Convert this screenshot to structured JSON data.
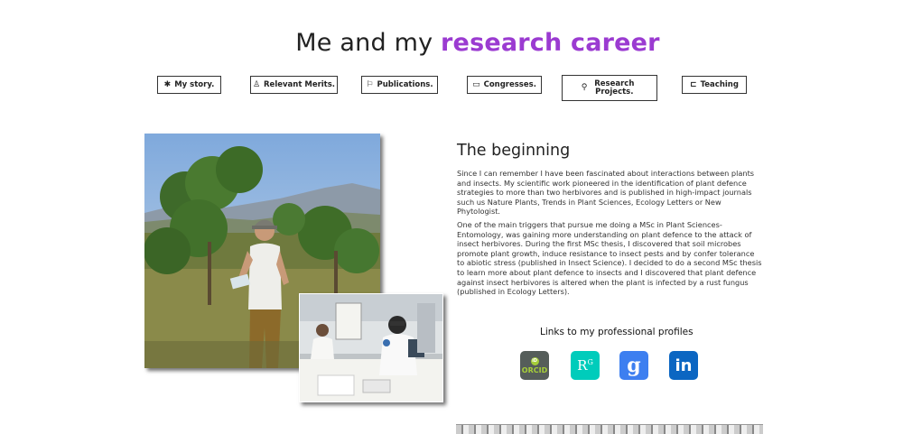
{
  "header": {
    "title_plain": "Me and my",
    "title_accent": "research career"
  },
  "nav": {
    "items": [
      {
        "label": "My story.",
        "icon": "asterisk-icon",
        "glyph": "✱"
      },
      {
        "label": "Relevant Merits.",
        "icon": "award-icon",
        "glyph": "♙"
      },
      {
        "label": "Publications.",
        "icon": "bookmark-icon",
        "glyph": "⚐"
      },
      {
        "label": "Congresses.",
        "icon": "monitor-icon",
        "glyph": "▭"
      },
      {
        "label": "Research Projects.",
        "icon": "search-icon",
        "glyph": "⚲"
      },
      {
        "label": "Teaching",
        "icon": "chat-icon",
        "glyph": "⊏"
      }
    ]
  },
  "main": {
    "section_title": "The beginning",
    "paragraph_1": "Since I can remember I have been fascinated about interactions between plants and insects. My scientific work pioneered in the identification of plant defence strategies to more than two herbivores and is published in high-impact journals such us Nature Plants, Trends in Plant Sciences, Ecology Letters or New Phytologist.",
    "paragraph_2": "One of the main triggers that pursue me doing a MSc in Plant Sciences-Entomology, was gaining more understanding on plant defence to the attack of insect herbivores. During the first MSc thesis, I discovered that soil microbes promote plant growth, induce resistance to insect pests and by confer tolerance to abiotic stress (published in Insect Science). I decided to do a second MSc thesis to learn more about plant defence to insects and I discovered that plant defence against insect herbivores is altered when the plant is infected by a rust fungus (published in Ecology Letters).",
    "links_title": "Links to my professional profiles"
  },
  "profiles": {
    "orcid_badge": "iD",
    "orcid_text": "ORCID",
    "researchgate_text": "R",
    "researchgate_sup": "G",
    "scholar_text": "g",
    "linkedin_text": "in"
  },
  "colors": {
    "accent": "#9b3bd1",
    "orcid": "#a6ce39",
    "researchgate": "#00ccbb",
    "scholar": "#3d7ff0",
    "linkedin": "#0b66c2"
  }
}
